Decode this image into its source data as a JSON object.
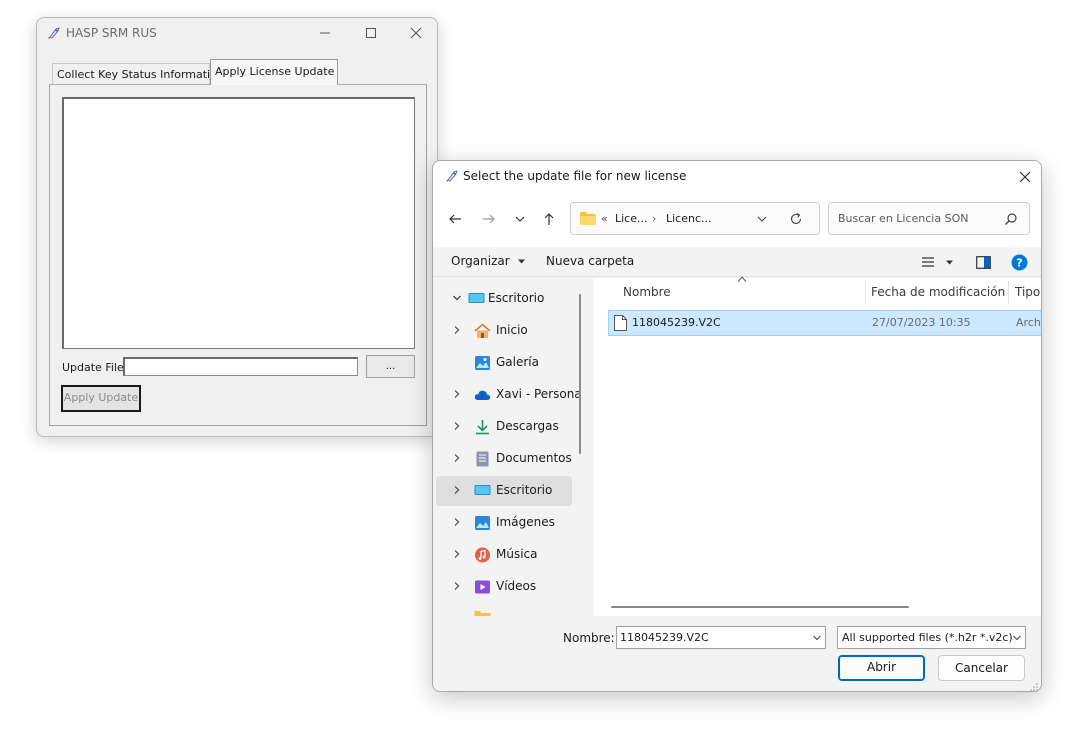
{
  "hasp_window": {
    "title": "HASP SRM RUS",
    "tabs": [
      {
        "label": "Collect Key Status Information",
        "active": false
      },
      {
        "label": "Apply License Update",
        "active": true
      }
    ],
    "update_file_label": "Update File",
    "update_file_value": "",
    "browse_label": "...",
    "apply_label": "Apply Update"
  },
  "dialog": {
    "title": "Select the update file for new license",
    "breadcrumb": {
      "overflow": "«",
      "segments": [
        "Lice...",
        "Licenc..."
      ],
      "separator": "›"
    },
    "search_placeholder": "Buscar en Licencia SON",
    "toolbar": {
      "organize": "Organizar",
      "new_folder": "Nueva carpeta"
    },
    "tree": [
      {
        "label": "Escritorio",
        "expanded": true,
        "icon": "desktop-icon"
      },
      {
        "label": "Inicio",
        "icon": "home-icon"
      },
      {
        "label": "Galería",
        "icon": "gallery-icon"
      },
      {
        "label": "Xavi - Persona",
        "icon": "cloud-icon"
      },
      {
        "label": "Descargas",
        "icon": "download-icon"
      },
      {
        "label": "Documentos",
        "icon": "document-icon"
      },
      {
        "label": "Escritorio",
        "icon": "desktop-icon",
        "selected": true
      },
      {
        "label": "Imágenes",
        "icon": "pictures-icon"
      },
      {
        "label": "Música",
        "icon": "music-icon"
      },
      {
        "label": "Vídeos",
        "icon": "video-icon"
      }
    ],
    "columns": {
      "name": "Nombre",
      "date": "Fecha de modificación",
      "type": "Tipo"
    },
    "files": [
      {
        "name": "118045239.V2C",
        "date": "27/07/2023 10:35",
        "type": "Archi"
      }
    ],
    "filename_label": "Nombre:",
    "filename_value": "118045239.V2C",
    "filter_value": "All supported files (*.h2r *.v2c)",
    "open_label": "Abrir",
    "cancel_label": "Cancelar",
    "colors": {
      "selection_bg": "#cce8ff",
      "selection_border": "#99d1ff",
      "accent": "#0067c0",
      "help": "#0078d4"
    }
  }
}
